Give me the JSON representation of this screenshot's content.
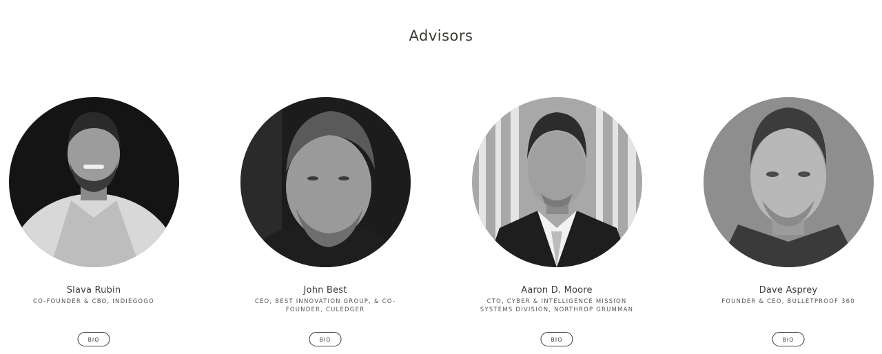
{
  "section": {
    "title": "Advisors"
  },
  "advisors": [
    {
      "name": "Slava Rubin",
      "role": "CO-FOUNDER & CBO, INDIEGOGO",
      "bio_label": "BIO",
      "photo": "portrait-photo"
    },
    {
      "name": "John Best",
      "role": "CEO, BEST INNOVATION GROUP, & CO-FOUNDER, CULEDGER",
      "bio_label": "BIO",
      "photo": "portrait-photo"
    },
    {
      "name": "Aaron D. Moore",
      "role": "CTO, CYBER & INTELLIGENCE MISSION SYSTEMS DIVISION, NORTHROP GRUMMAN",
      "bio_label": "BIO",
      "photo": "portrait-photo"
    },
    {
      "name": "Dave Asprey",
      "role": "FOUNDER & CEO, BULLETPROOF 360",
      "bio_label": "BIO",
      "photo": "portrait-photo"
    }
  ]
}
